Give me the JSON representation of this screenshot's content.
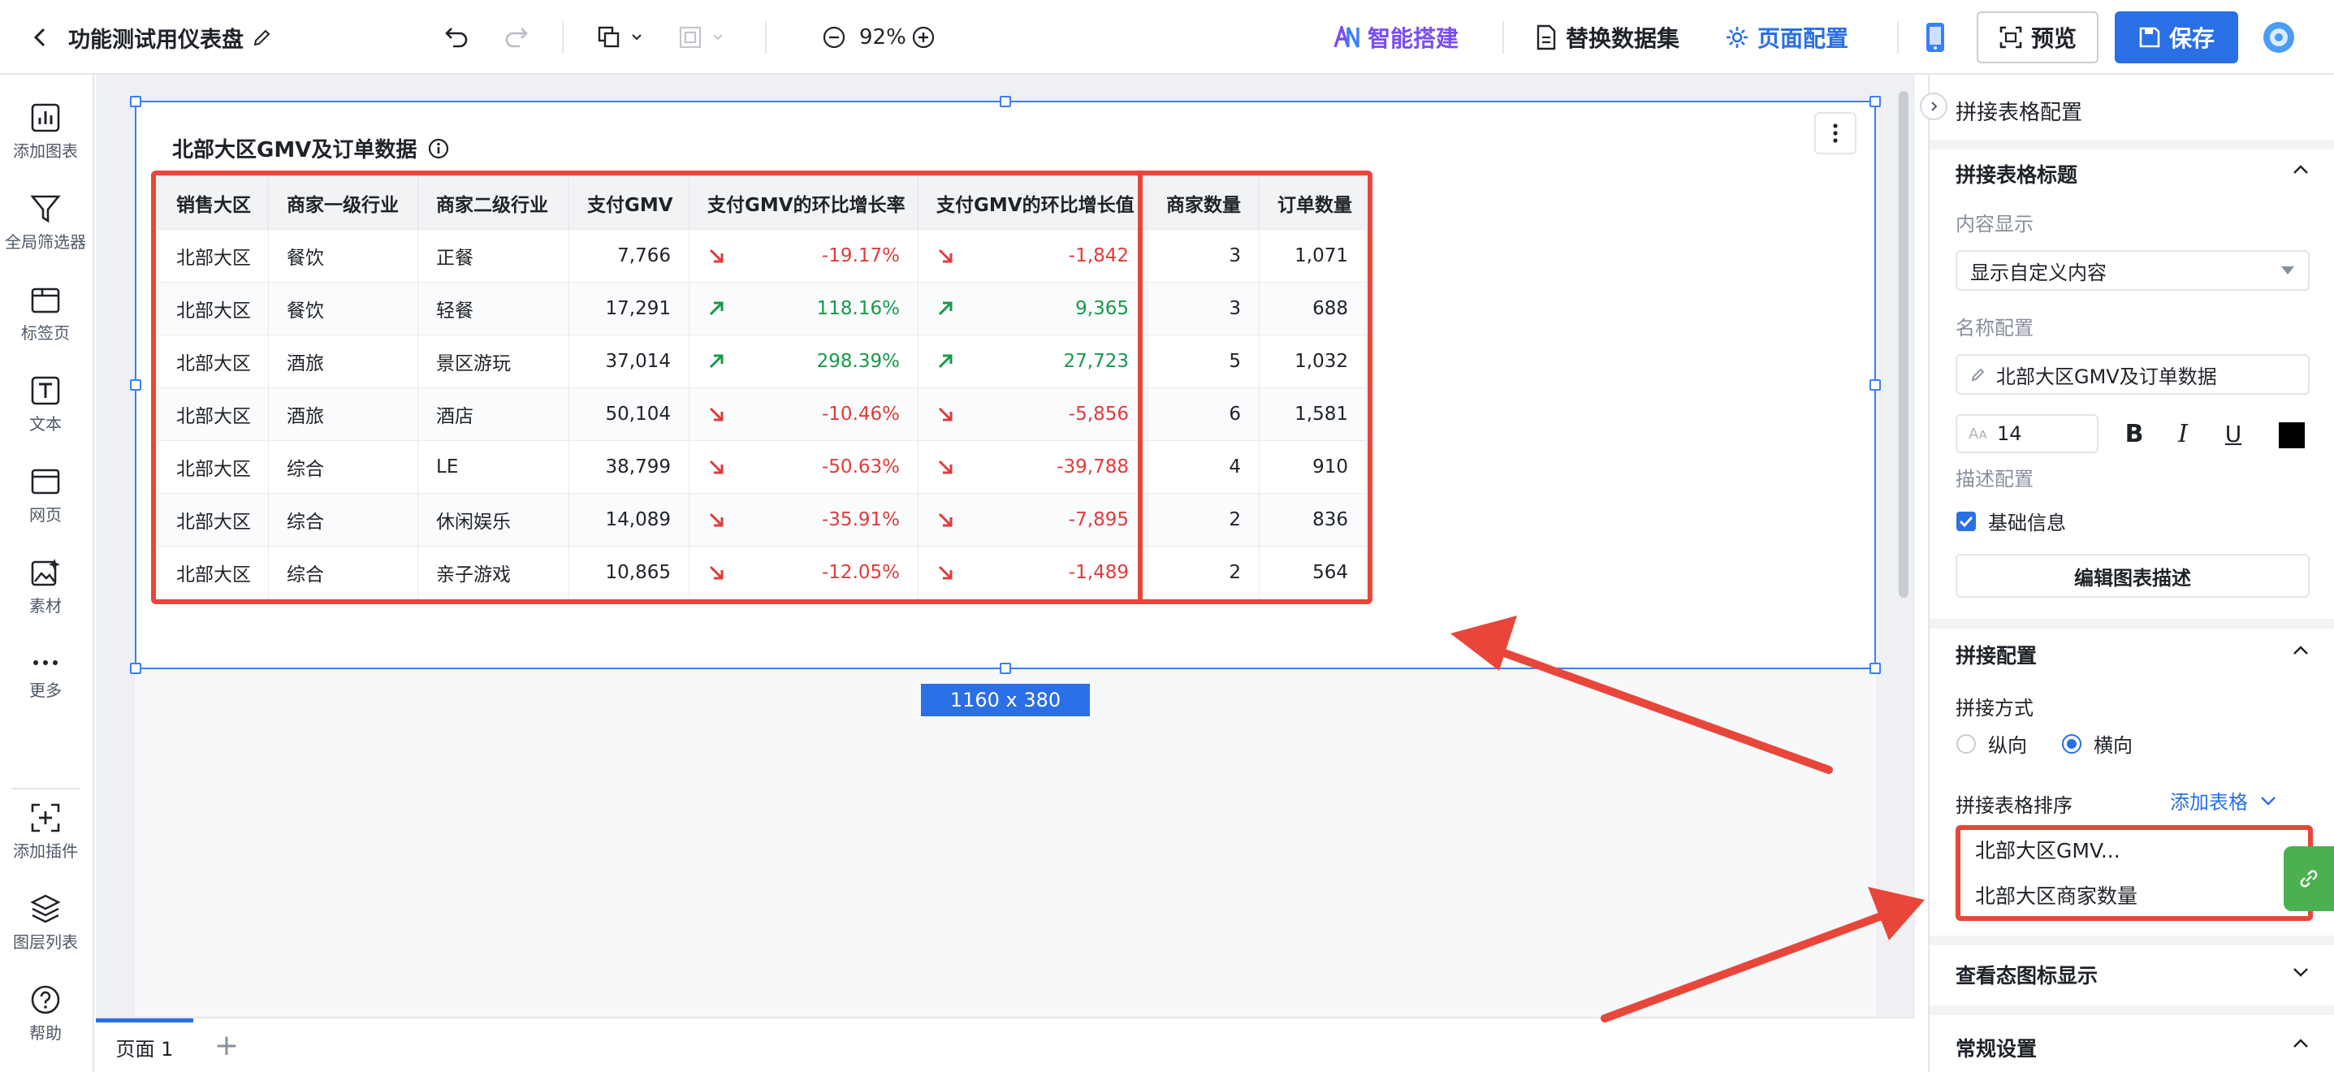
{
  "header": {
    "title": "功能测试用仪表盘",
    "zoom": "92%",
    "ai_build": "智能搭建",
    "replace_dataset": "替换数据集",
    "page_config": "页面配置",
    "preview": "预览",
    "save": "保存",
    "colors": {
      "brand": "#2a6fe6",
      "ai": "#7b4cf6"
    }
  },
  "rail": {
    "items": [
      {
        "label": "添加图表",
        "icon": "chart-icon"
      },
      {
        "label": "全局筛选器",
        "icon": "filter-icon"
      },
      {
        "label": "标签页",
        "icon": "tab-icon"
      },
      {
        "label": "文本",
        "icon": "text-icon"
      },
      {
        "label": "网页",
        "icon": "webpage-icon"
      },
      {
        "label": "素材",
        "icon": "material-icon"
      },
      {
        "label": "更多",
        "icon": "more-icon"
      },
      {
        "label": "添加插件",
        "icon": "plugin-icon"
      },
      {
        "label": "图层列表",
        "icon": "layers-icon"
      },
      {
        "label": "帮助",
        "icon": "help-icon"
      }
    ]
  },
  "widget": {
    "title": "北部大区GMV及订单数据",
    "size_label": "1160 x 380",
    "columns": [
      "销售大区",
      "商家一级行业",
      "商家二级行业",
      "支付GMV",
      "支付GMV的环比增长率",
      "支付GMV的环比增长值",
      "商家数量",
      "订单数量"
    ],
    "rows": [
      {
        "region": "北部大区",
        "ind1": "餐饮",
        "ind2": "正餐",
        "gmv": "7,766",
        "rate": "-19.17%",
        "delta": "-1,842",
        "dir": "down",
        "merchants": "3",
        "orders": "1,071"
      },
      {
        "region": "北部大区",
        "ind1": "餐饮",
        "ind2": "轻餐",
        "gmv": "17,291",
        "rate": "118.16%",
        "delta": "9,365",
        "dir": "up",
        "merchants": "3",
        "orders": "688"
      },
      {
        "region": "北部大区",
        "ind1": "酒旅",
        "ind2": "景区游玩",
        "gmv": "37,014",
        "rate": "298.39%",
        "delta": "27,723",
        "dir": "up",
        "merchants": "5",
        "orders": "1,032"
      },
      {
        "region": "北部大区",
        "ind1": "酒旅",
        "ind2": "酒店",
        "gmv": "50,104",
        "rate": "-10.46%",
        "delta": "-5,856",
        "dir": "down",
        "merchants": "6",
        "orders": "1,581"
      },
      {
        "region": "北部大区",
        "ind1": "综合",
        "ind2": "LE",
        "gmv": "38,799",
        "rate": "-50.63%",
        "delta": "-39,788",
        "dir": "down",
        "merchants": "4",
        "orders": "910"
      },
      {
        "region": "北部大区",
        "ind1": "综合",
        "ind2": "休闲娱乐",
        "gmv": "14,089",
        "rate": "-35.91%",
        "delta": "-7,895",
        "dir": "down",
        "merchants": "2",
        "orders": "836"
      },
      {
        "region": "北部大区",
        "ind1": "综合",
        "ind2": "亲子游戏",
        "gmv": "10,865",
        "rate": "-12.05%",
        "delta": "-1,489",
        "dir": "down",
        "merchants": "2",
        "orders": "564"
      }
    ]
  },
  "bottom": {
    "page_tab": "页面 1",
    "add": "+"
  },
  "panel": {
    "title": "拼接表格配置",
    "sec_title": "拼接表格标题",
    "content_display_label": "内容显示",
    "content_display_value": "显示自定义内容",
    "name_config_label": "名称配置",
    "name_value": "北部大区GMV及订单数据",
    "font_size": "14",
    "desc_config_label": "描述配置",
    "basic_info": "基础信息",
    "edit_desc": "编辑图表描述",
    "sec_join": "拼接配置",
    "join_mode_label": "拼接方式",
    "vertical": "纵向",
    "horizontal": "横向",
    "order_label": "拼接表格排序",
    "add_table": "添加表格",
    "order_items": [
      "北部大区GMV...",
      "北部大区商家数量"
    ],
    "sec_view_icon": "查看态图标显示",
    "sec_general": "常规设置"
  }
}
